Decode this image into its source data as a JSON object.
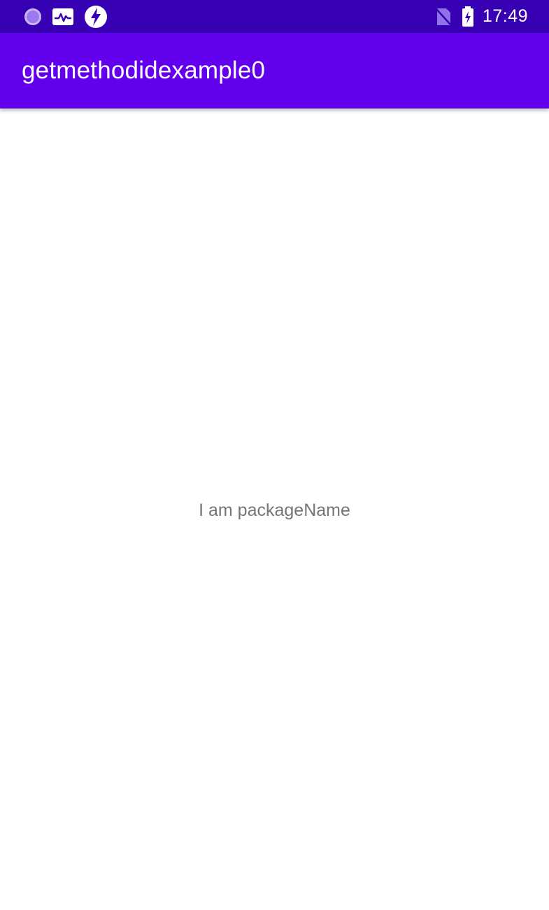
{
  "status_bar": {
    "time": "17:49",
    "left_icons": [
      "record-dot-icon",
      "activity-monitor-icon",
      "data-saver-icon"
    ],
    "right_icons": [
      "no-sim-icon",
      "battery-charging-icon"
    ],
    "color": "#3700b3"
  },
  "app_bar": {
    "title": "getmethodidexample0",
    "color": "#6200ee"
  },
  "main": {
    "message": "I am packageName",
    "text_color": "#757575"
  }
}
